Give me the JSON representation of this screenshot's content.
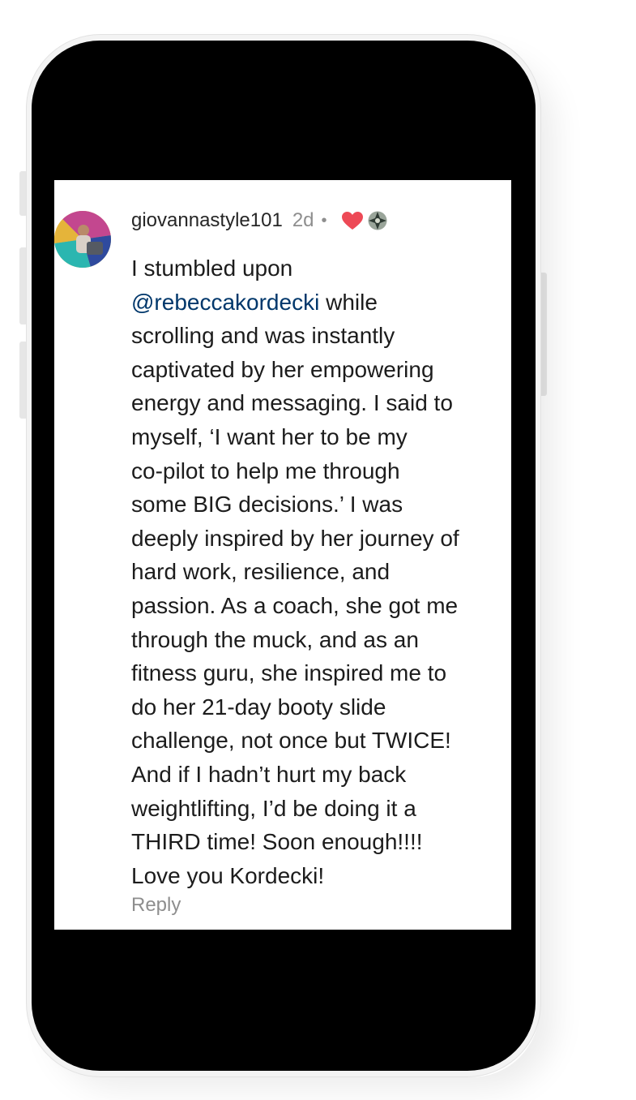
{
  "comment": {
    "username": "giovannastyle101",
    "age": "2d",
    "separator": "•",
    "liked_by_author": true,
    "icons": [
      "heart-icon",
      "author-avatar-icon"
    ],
    "mention": "@rebeccakordecki",
    "lines": [
      "I stumbled upon",
      " while",
      "scrolling and was instantly",
      "captivated by her empowering",
      "energy and messaging. I said to",
      "myself, ‘I want her to be my",
      "co-pilot to help me through",
      "some BIG decisions.’ I was",
      "deeply inspired by her journey of",
      "hard work, resilience, and",
      "passion. As a coach, she got me",
      "through the muck, and as an",
      "fitness guru, she inspired me to",
      "do her 21-day booty slide",
      "challenge, not once but TWICE!",
      "And if I hadn’t hurt my back",
      "weightlifting, I’d be doing it a",
      "THIRD time! Soon enough!!!!",
      "Love you Kordecki!"
    ],
    "reply_label": "Reply"
  },
  "colors": {
    "text": "#1c1c1c",
    "username": "#262626",
    "muted": "#8e8e8e",
    "mention": "#00376b",
    "heart": "#ed4956",
    "phone_screen": "#000000"
  }
}
